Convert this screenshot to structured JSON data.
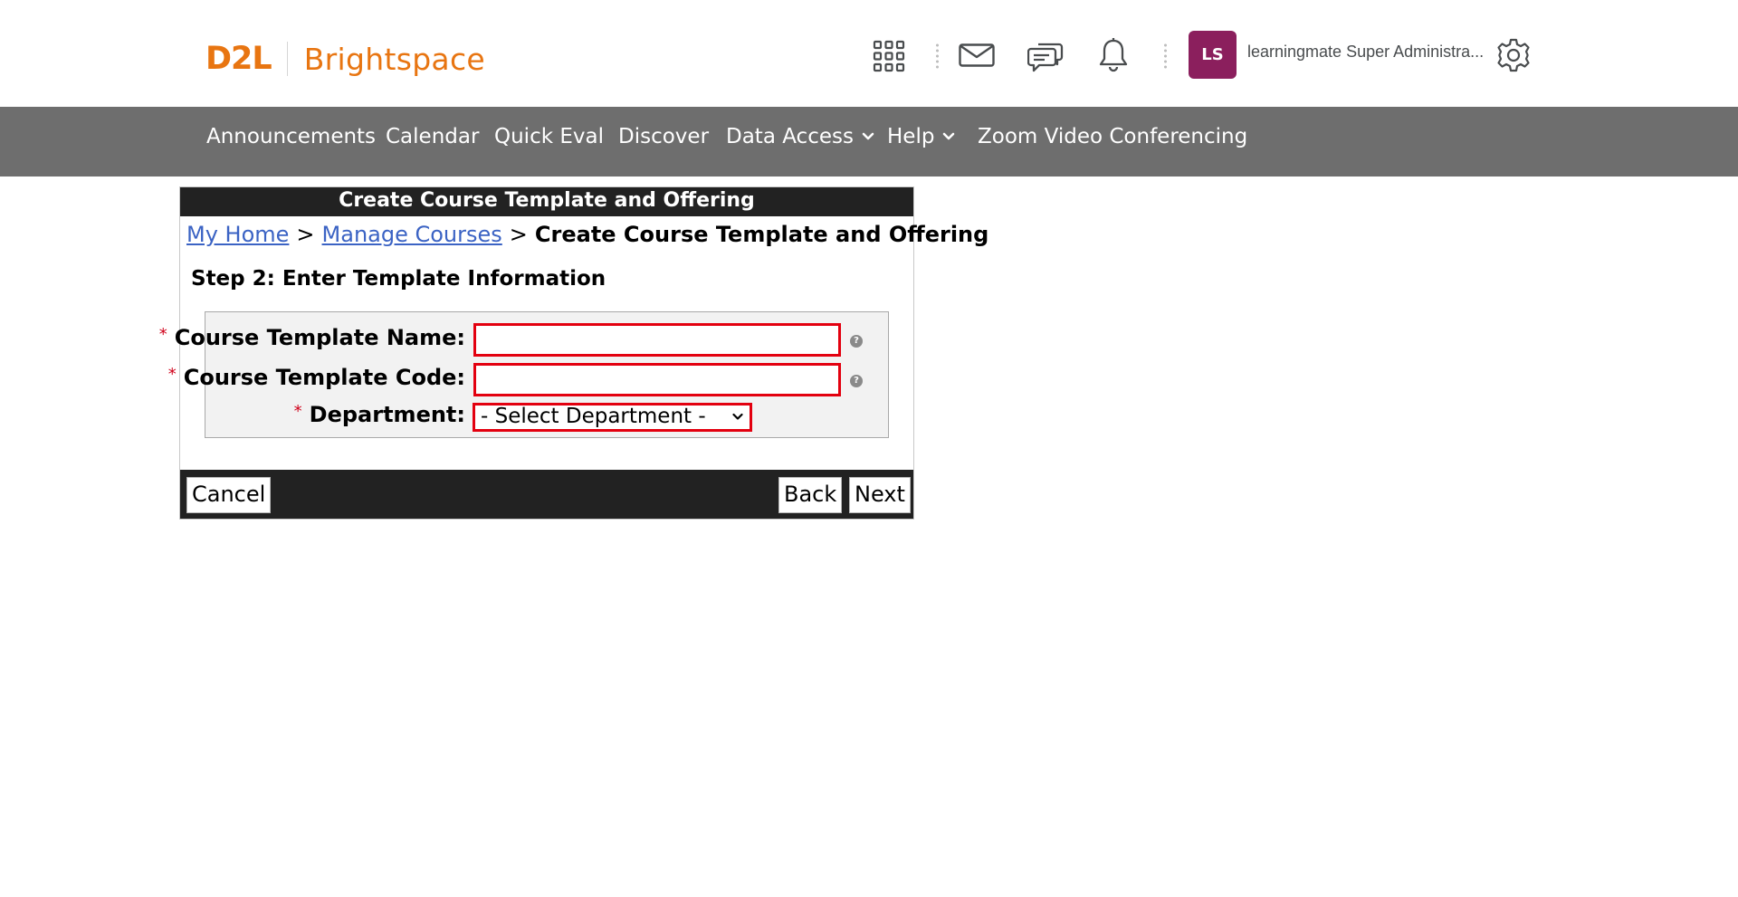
{
  "header": {
    "logo_primary": "D2L",
    "logo_secondary": "Brightspace",
    "avatar_initials": "LS",
    "user_name": "learningmate Super Administra..."
  },
  "navbar": {
    "items": [
      {
        "label": "Announcements"
      },
      {
        "label": "Calendar"
      },
      {
        "label": "Quick Eval"
      },
      {
        "label": "Discover"
      },
      {
        "label": "Data Access",
        "has_dropdown": true
      },
      {
        "label": "Help",
        "has_dropdown": true
      },
      {
        "label": "Zoom Video Conferencing"
      }
    ]
  },
  "panel": {
    "title": "Create Course Template and Offering",
    "breadcrumb": {
      "home": "My Home",
      "separator": ">",
      "manage": "Manage Courses",
      "current": "Create Course Template and Offering"
    },
    "step_heading": "Step 2: Enter Template Information",
    "form": {
      "required_marker": "*",
      "name_label": "Course Template Name:",
      "name_value": "",
      "code_label": "Course Template Code:",
      "code_value": "",
      "department_label": "Department:",
      "department_selected": "- Select Department -",
      "help_glyph": "?"
    },
    "buttons": {
      "cancel": "Cancel",
      "back": "Back",
      "next": "Next"
    }
  },
  "colors": {
    "brand_orange": "#e87511",
    "nav_bg": "#6e6e6e",
    "avatar_bg": "#8b1f5d",
    "error_border": "#e3000f",
    "link": "#3b63c4",
    "dark_bar": "#222222"
  },
  "icons": [
    "apps-grid-icon",
    "mail-icon",
    "chat-icon",
    "bell-icon",
    "gear-icon",
    "chevron-down-icon",
    "help-icon"
  ]
}
